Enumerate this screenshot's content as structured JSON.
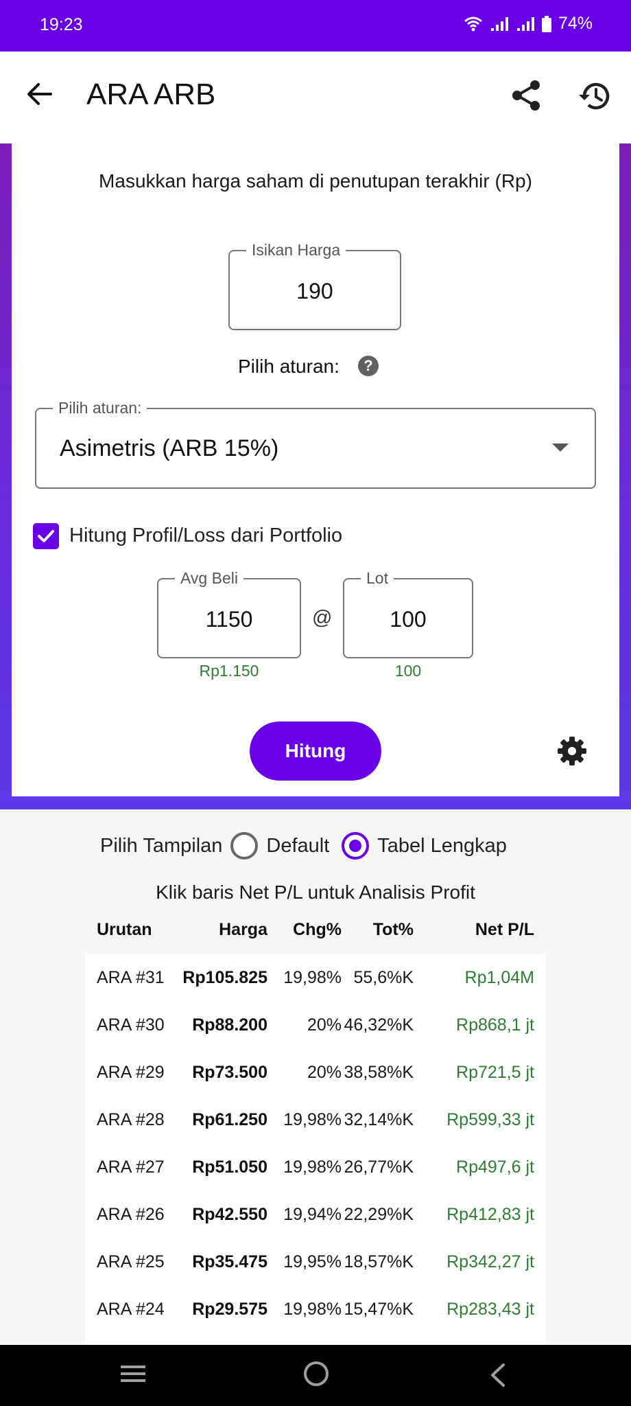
{
  "status_bar": {
    "time": "19:23",
    "battery": "74%"
  },
  "app_bar": {
    "title": "ARA ARB"
  },
  "form": {
    "instruction": "Masukkan harga saham di penutupan terakhir (Rp)",
    "price_label": "Isikan Harga",
    "price_value": "190",
    "rule_prompt": "Pilih aturan:",
    "help_symbol": "?",
    "rule_field_label": "Pilih aturan:",
    "rule_selected": "Asimetris (ARB 15%)",
    "portfolio_checkbox_label": "Hitung Profil/Loss dari Portfolio",
    "portfolio_checked": true,
    "avg_label": "Avg Beli",
    "avg_value": "1150",
    "avg_helper": "Rp1.150",
    "at_symbol": "@",
    "lot_label": "Lot",
    "lot_value": "100",
    "lot_helper": "100",
    "calculate_label": "Hitung"
  },
  "view": {
    "label": "Pilih Tampilan",
    "options": [
      "Default",
      "Tabel Lengkap"
    ],
    "selected": "Tabel Lengkap"
  },
  "table": {
    "hint": "Klik baris Net P/L untuk Analisis Profit",
    "headers": [
      "Urutan",
      "Harga",
      "Chg%",
      "Tot%",
      "Net P/L"
    ],
    "rows": [
      [
        "ARA #31",
        "Rp105.825",
        "19,98%",
        "55,6%K",
        "Rp1,04M"
      ],
      [
        "ARA #30",
        "Rp88.200",
        "20%",
        "46,32%K",
        "Rp868,1 jt"
      ],
      [
        "ARA #29",
        "Rp73.500",
        "20%",
        "38,58%K",
        "Rp721,5 jt"
      ],
      [
        "ARA #28",
        "Rp61.250",
        "19,98%",
        "32,14%K",
        "Rp599,33 jt"
      ],
      [
        "ARA #27",
        "Rp51.050",
        "19,98%",
        "26,77%K",
        "Rp497,6 jt"
      ],
      [
        "ARA #26",
        "Rp42.550",
        "19,94%",
        "22,29%K",
        "Rp412,83 jt"
      ],
      [
        "ARA #25",
        "Rp35.475",
        "19,95%",
        "18,57%K",
        "Rp342,27 jt"
      ],
      [
        "ARA #24",
        "Rp29.575",
        "19,98%",
        "15,47%K",
        "Rp283,43 jt"
      ]
    ]
  },
  "colors": {
    "accent": "#6a00e6",
    "positive": "#2e7d32"
  }
}
